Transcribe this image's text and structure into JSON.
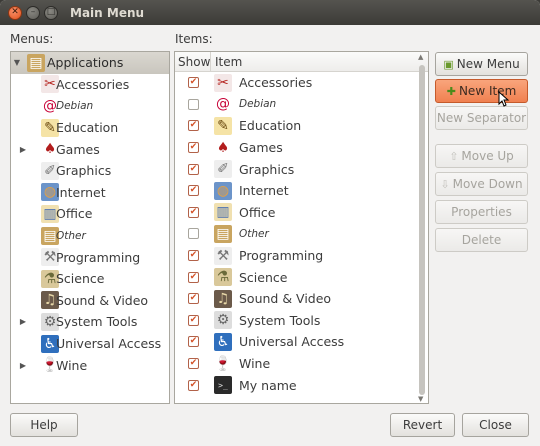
{
  "window": {
    "title": "Main Menu",
    "controls": {
      "close": "✕",
      "minimize": "–",
      "maximize": "□"
    }
  },
  "labels": {
    "menus": "Menus:",
    "items": "Items:"
  },
  "menus_tree": [
    {
      "label": "Applications",
      "icon": "applications-icon",
      "expander": "▼",
      "level": 0,
      "selected": true,
      "italic": false
    },
    {
      "label": "Accessories",
      "icon": "accessories-icon",
      "level": 1,
      "italic": false
    },
    {
      "label": "Debian",
      "icon": "debian-icon",
      "level": 1,
      "italic": true
    },
    {
      "label": "Education",
      "icon": "education-icon",
      "level": 1,
      "italic": false
    },
    {
      "label": "Games",
      "icon": "games-icon",
      "expander": "▶",
      "level": 1,
      "italic": false
    },
    {
      "label": "Graphics",
      "icon": "graphics-icon",
      "level": 1,
      "italic": false
    },
    {
      "label": "Internet",
      "icon": "internet-icon",
      "level": 1,
      "italic": false
    },
    {
      "label": "Office",
      "icon": "office-icon",
      "level": 1,
      "italic": false
    },
    {
      "label": "Other",
      "icon": "other-icon",
      "level": 1,
      "italic": true
    },
    {
      "label": "Programming",
      "icon": "programming-icon",
      "level": 1,
      "italic": false
    },
    {
      "label": "Science",
      "icon": "science-icon",
      "level": 1,
      "italic": false
    },
    {
      "label": "Sound & Video",
      "icon": "sound-video-icon",
      "level": 1,
      "italic": false
    },
    {
      "label": "System Tools",
      "icon": "system-tools-icon",
      "expander": "▶",
      "level": 1,
      "italic": false
    },
    {
      "label": "Universal Access",
      "icon": "universal-access-icon",
      "level": 1,
      "italic": false
    },
    {
      "label": "Wine",
      "icon": "wine-icon",
      "expander": "▶",
      "level": 1,
      "italic": false
    }
  ],
  "items_table": {
    "columns": {
      "show": "Show",
      "item": "Item"
    },
    "rows": [
      {
        "show": true,
        "label": "Accessories",
        "icon": "accessories-icon",
        "italic": false
      },
      {
        "show": false,
        "label": "Debian",
        "icon": "debian-icon",
        "italic": true
      },
      {
        "show": true,
        "label": "Education",
        "icon": "education-icon",
        "italic": false
      },
      {
        "show": true,
        "label": "Games",
        "icon": "games-icon",
        "italic": false
      },
      {
        "show": true,
        "label": "Graphics",
        "icon": "graphics-icon",
        "italic": false
      },
      {
        "show": true,
        "label": "Internet",
        "icon": "internet-icon",
        "italic": false
      },
      {
        "show": true,
        "label": "Office",
        "icon": "office-icon",
        "italic": false
      },
      {
        "show": false,
        "label": "Other",
        "icon": "other-icon",
        "italic": true
      },
      {
        "show": true,
        "label": "Programming",
        "icon": "programming-icon",
        "italic": false
      },
      {
        "show": true,
        "label": "Science",
        "icon": "science-icon",
        "italic": false
      },
      {
        "show": true,
        "label": "Sound & Video",
        "icon": "sound-video-icon",
        "italic": false
      },
      {
        "show": true,
        "label": "System Tools",
        "icon": "system-tools-icon",
        "italic": false
      },
      {
        "show": true,
        "label": "Universal Access",
        "icon": "universal-access-icon",
        "italic": false
      },
      {
        "show": true,
        "label": "Wine",
        "icon": "wine-icon",
        "italic": false
      },
      {
        "show": true,
        "label": "My name",
        "icon": "terminal-icon",
        "italic": false
      }
    ]
  },
  "actions": {
    "new_menu": "New Menu",
    "new_item": "New Item",
    "new_separator": "New Separator",
    "move_up": "Move Up",
    "move_down": "Move Down",
    "properties": "Properties",
    "delete": "Delete"
  },
  "footer": {
    "help": "Help",
    "revert": "Revert",
    "close": "Close"
  },
  "colors": {
    "accent": "#f08050",
    "check": "#d4532a",
    "titlebar": "#3c3b37"
  }
}
